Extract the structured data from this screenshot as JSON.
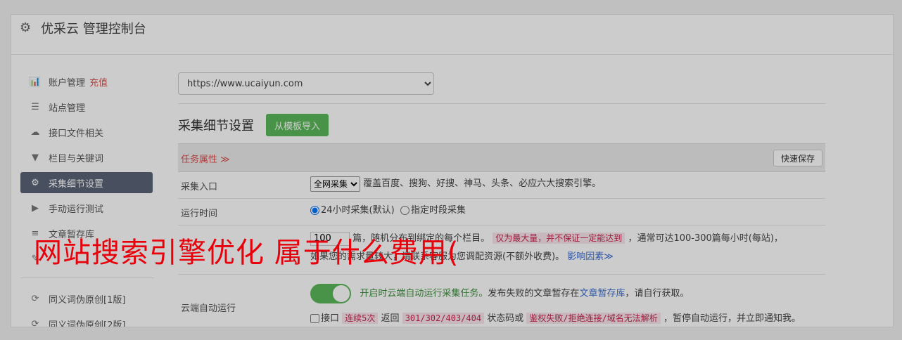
{
  "header": {
    "gear_icon": "gear-icon",
    "title": "优采云 管理控制台"
  },
  "sidebar": {
    "items": [
      {
        "icon": "bar-chart-icon",
        "glyph": "📊",
        "label": "账户管理",
        "extra": "充值"
      },
      {
        "icon": "server-icon",
        "glyph": "☰",
        "label": "站点管理"
      },
      {
        "icon": "cloud-upload-icon",
        "glyph": "☁",
        "label": "接口文件相关"
      },
      {
        "icon": "filter-icon",
        "glyph": "▼",
        "label": "栏目与关键词"
      },
      {
        "icon": "gears-icon",
        "glyph": "⚙",
        "label": "采集细节设置"
      },
      {
        "icon": "play-circle-icon",
        "glyph": "▶",
        "label": "手动运行测试"
      },
      {
        "icon": "database-icon",
        "glyph": "≡",
        "label": "文章暂存库"
      },
      {
        "icon": "edit-icon",
        "glyph": "✎",
        "label": ""
      },
      {
        "icon": "refresh-icon",
        "glyph": "⟳",
        "label": "同义词伪原创[1版]"
      },
      {
        "icon": "refresh-icon",
        "glyph": "⟳",
        "label": "同义词伪原创[2版]"
      }
    ]
  },
  "main": {
    "site_select": {
      "value": "https://www.ucaiyun.com"
    },
    "section_title": "采集细节设置",
    "import_button": "从模板导入",
    "task_attr": "任务属性 ≫",
    "quick_save": "快速保存",
    "rows": {
      "entry": {
        "label": "采集入口",
        "select_value": "全网采集",
        "text": "覆盖百度、搜狗、好搜、神马、头条、必应六大搜索引擎。"
      },
      "time": {
        "label": "运行时间",
        "opt1": "24小时采集(默认)",
        "opt2": "指定时段采集"
      },
      "count": {
        "input_value": "100",
        "text1": "篇，随机分布到绑定的每个栏目。",
        "tag": "仅为最大量，并不保证一定能达到",
        "text2": "，通常可达100-300篇每小时(每站)，",
        "line2": "如果您的需求量较大，请联系客服为您调配资源(不额外收费)。",
        "link": "影响因素≫"
      },
      "cloud": {
        "label": "云端自动运行",
        "toggle_text": "开启时云端自动运行采集任务。",
        "text": "发布失败的文章暂存在",
        "link": "文章暂存库",
        "text_end": "，请自行获取。",
        "check_label": "接口",
        "tag1": "连续5次",
        "t1": "返回",
        "tag2": "301/302/403/404",
        "t2": "状态码或",
        "tag3": "鉴权失败/拒绝连接/域名无法解析",
        "t3": "，暂停自动运行，并立即通知我。"
      }
    }
  },
  "overlay": {
    "headline": "网站搜索引擎优化 属于什么费用("
  },
  "colors": {
    "accent_green": "#5cb85c",
    "active_item": "#5b6577",
    "warning_red": "#d9534f",
    "headline_red": "#e8000b"
  }
}
